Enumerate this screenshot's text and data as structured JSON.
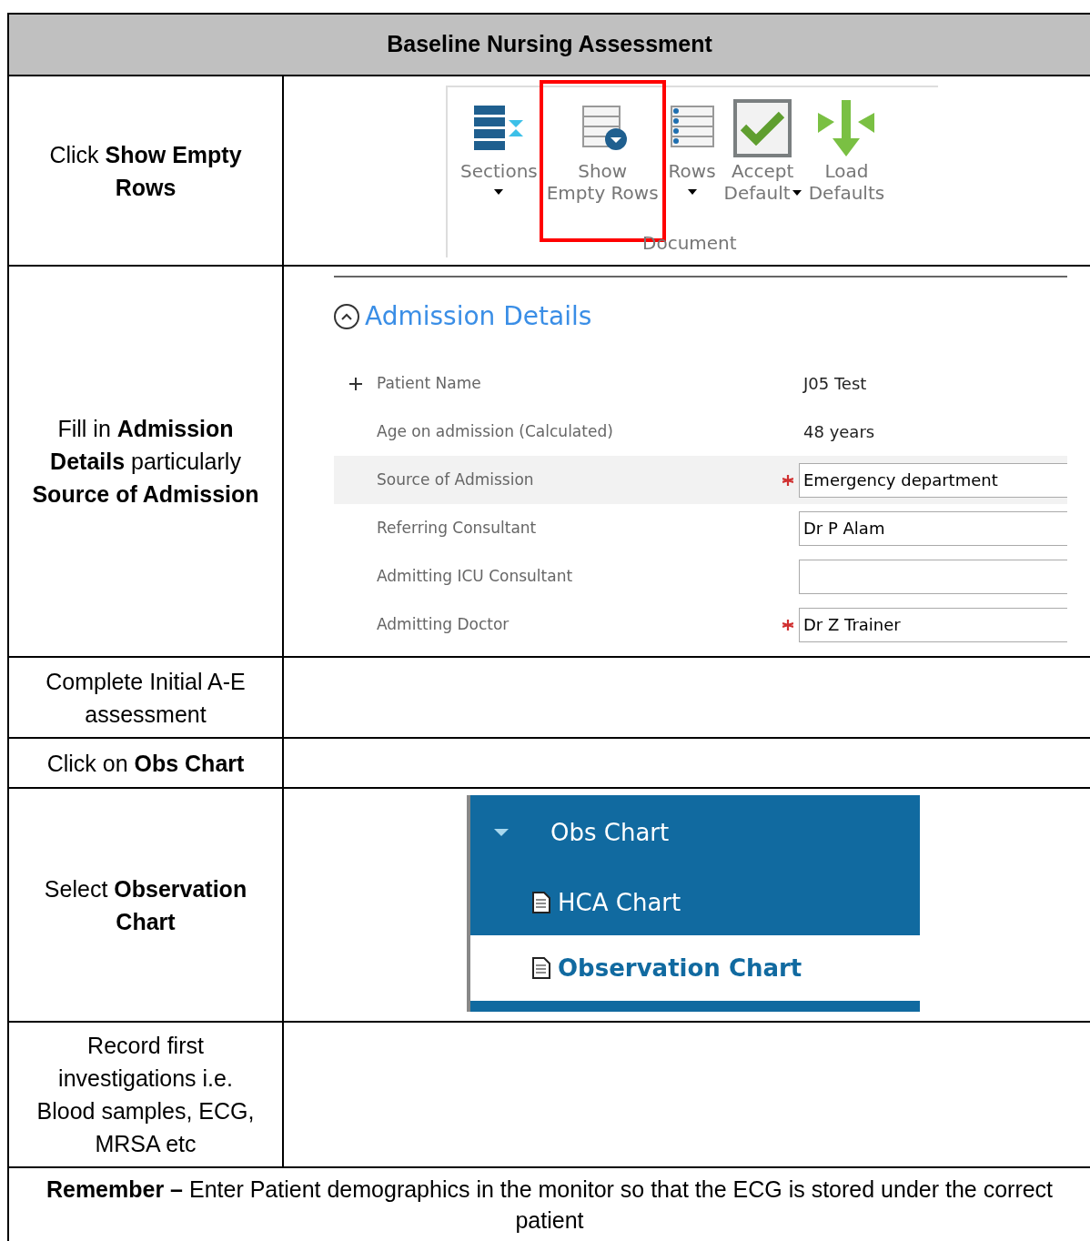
{
  "title": "Baseline Nursing Assessment",
  "steps": [
    {
      "instruction": "Click **Show Empty Rows**",
      "panel": {
        "kind": "ribbon",
        "group": "Document",
        "buttons": [
          {
            "label": "Sections",
            "dropdown": true,
            "highlighted": false
          },
          {
            "label": "Show\nEmpty Rows",
            "dropdown": false,
            "highlighted": true
          },
          {
            "label": "Rows",
            "dropdown": true,
            "highlighted": false
          },
          {
            "label": "Accept\nDefault",
            "dropdown": true,
            "highlighted": false
          },
          {
            "label": "Load\nDefaults",
            "dropdown": false,
            "highlighted": false
          }
        ]
      }
    },
    {
      "instruction": "Fill in **Admission Details** particularly **Source of Admission**",
      "panel": {
        "kind": "form",
        "section": "Admission Details",
        "expanded": true,
        "fields": [
          {
            "label": "Patient Name",
            "value": "J05 Test",
            "kind": "text",
            "required": false,
            "expandable": true,
            "highlighted": false
          },
          {
            "label": "Age on admission (Calculated)",
            "value": "48 years",
            "kind": "text",
            "required": false,
            "expandable": false,
            "highlighted": false
          },
          {
            "label": "Source of Admission",
            "value": "Emergency department",
            "kind": "input",
            "required": true,
            "expandable": false,
            "highlighted": true
          },
          {
            "label": "Referring Consultant",
            "value": "Dr P Alam",
            "kind": "input",
            "required": false,
            "expandable": false,
            "highlighted": false
          },
          {
            "label": "Admitting ICU Consultant",
            "kind": "input",
            "required": false,
            "expandable": false,
            "highlighted": false
          },
          {
            "label": "Admitting Doctor",
            "value": "Dr Z Trainer",
            "kind": "input",
            "required": true,
            "expandable": false,
            "highlighted": false
          }
        ]
      }
    },
    {
      "instruction": "Complete Initial A-E assessment"
    },
    {
      "instruction": "Click on **Obs Chart**"
    },
    {
      "instruction": "Select **Observation Chart**",
      "panel": {
        "kind": "nav",
        "items": [
          {
            "label": "Obs Chart",
            "kind": "group",
            "expanded": true,
            "selected": false
          },
          {
            "label": "HCA Chart",
            "kind": "item",
            "selected": false
          },
          {
            "label": "Observation Chart",
            "kind": "item",
            "selected": true
          }
        ]
      }
    },
    {
      "instruction": "Record first investigations i.e. Blood samples, ECG, MRSA etc"
    }
  ],
  "note": "**Remember –** Enter Patient demographics in the monitor so that the ECG is stored under the correct patient"
}
